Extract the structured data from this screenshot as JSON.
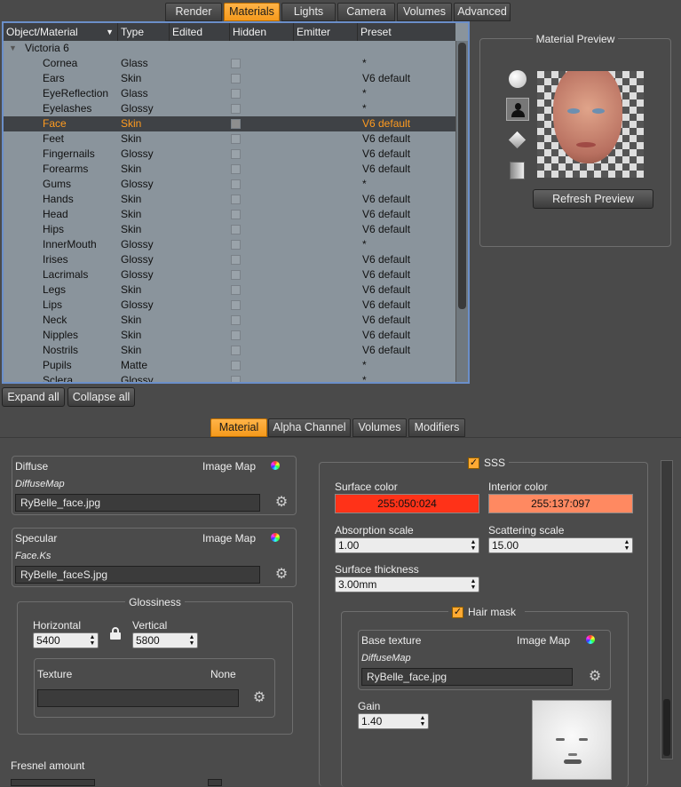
{
  "top_tabs": [
    "Render",
    "Materials",
    "Lights",
    "Camera",
    "Volumes",
    "Advanced"
  ],
  "table": {
    "columns": [
      "Object/Material",
      "Type",
      "Edited",
      "Hidden",
      "Emitter",
      "Preset"
    ],
    "group": "Victoria 6",
    "rows": [
      {
        "name": "Cornea",
        "type": "Glass",
        "preset": "*"
      },
      {
        "name": "Ears",
        "type": "Skin",
        "preset": "V6 default"
      },
      {
        "name": "EyeReflection",
        "type": "Glass",
        "preset": "*"
      },
      {
        "name": "Eyelashes",
        "type": "Glossy",
        "preset": "*"
      },
      {
        "name": "Face",
        "type": "Skin",
        "preset": "V6 default"
      },
      {
        "name": "Feet",
        "type": "Skin",
        "preset": "V6 default"
      },
      {
        "name": "Fingernails",
        "type": "Glossy",
        "preset": "V6 default"
      },
      {
        "name": "Forearms",
        "type": "Skin",
        "preset": "V6 default"
      },
      {
        "name": "Gums",
        "type": "Glossy",
        "preset": "*"
      },
      {
        "name": "Hands",
        "type": "Skin",
        "preset": "V6 default"
      },
      {
        "name": "Head",
        "type": "Skin",
        "preset": "V6 default"
      },
      {
        "name": "Hips",
        "type": "Skin",
        "preset": "V6 default"
      },
      {
        "name": "InnerMouth",
        "type": "Glossy",
        "preset": "*"
      },
      {
        "name": "Irises",
        "type": "Glossy",
        "preset": "V6 default"
      },
      {
        "name": "Lacrimals",
        "type": "Glossy",
        "preset": "V6 default"
      },
      {
        "name": "Legs",
        "type": "Skin",
        "preset": "V6 default"
      },
      {
        "name": "Lips",
        "type": "Glossy",
        "preset": "V6 default"
      },
      {
        "name": "Neck",
        "type": "Skin",
        "preset": "V6 default"
      },
      {
        "name": "Nipples",
        "type": "Skin",
        "preset": "V6 default"
      },
      {
        "name": "Nostrils",
        "type": "Skin",
        "preset": "V6 default"
      },
      {
        "name": "Pupils",
        "type": "Matte",
        "preset": "*"
      },
      {
        "name": "Sclera",
        "type": "Glossy",
        "preset": "*"
      }
    ]
  },
  "expand_all": "Expand all",
  "collapse_all": "Collapse all",
  "preview": {
    "title": "Material Preview",
    "refresh": "Refresh Preview"
  },
  "sub_tabs": [
    "Material",
    "Alpha Channel",
    "Volumes",
    "Modifiers"
  ],
  "diffuse": {
    "title": "Diffuse",
    "image_map": "Image Map",
    "map": "DiffuseMap",
    "file": "RyBelle_face.jpg"
  },
  "specular": {
    "title": "Specular",
    "image_map": "Image Map",
    "map": "Face.Ks",
    "file": "RyBelle_faceS.jpg"
  },
  "glossiness": {
    "title": "Glossiness",
    "horizontal_label": "Horizontal",
    "horizontal": "5400",
    "vertical_label": "Vertical",
    "vertical": "5800",
    "texture_label": "Texture",
    "texture_value": "None",
    "texture_file": ""
  },
  "fresnel_label": "Fresnel amount",
  "sss": {
    "label": "SSS",
    "surface_label": "Surface color",
    "surface_value": "255:050:024",
    "surface_hex": "#ff3218",
    "interior_label": "Interior color",
    "interior_value": "255:137:097",
    "interior_hex": "#ff8961",
    "absorption_label": "Absorption scale",
    "absorption": "1.00",
    "scattering_label": "Scattering scale",
    "scattering": "15.00",
    "thickness_label": "Surface thickness",
    "thickness": "3.00mm"
  },
  "hair_mask": {
    "label": "Hair mask",
    "base_label": "Base texture",
    "image_map": "Image Map",
    "map": "DiffuseMap",
    "file": "RyBelle_face.jpg",
    "gain_label": "Gain",
    "gain": "1.40"
  },
  "colors": {
    "accent": "#f59a1c",
    "selection": "#ff9b1f",
    "table_border": "#6b8fc9"
  }
}
